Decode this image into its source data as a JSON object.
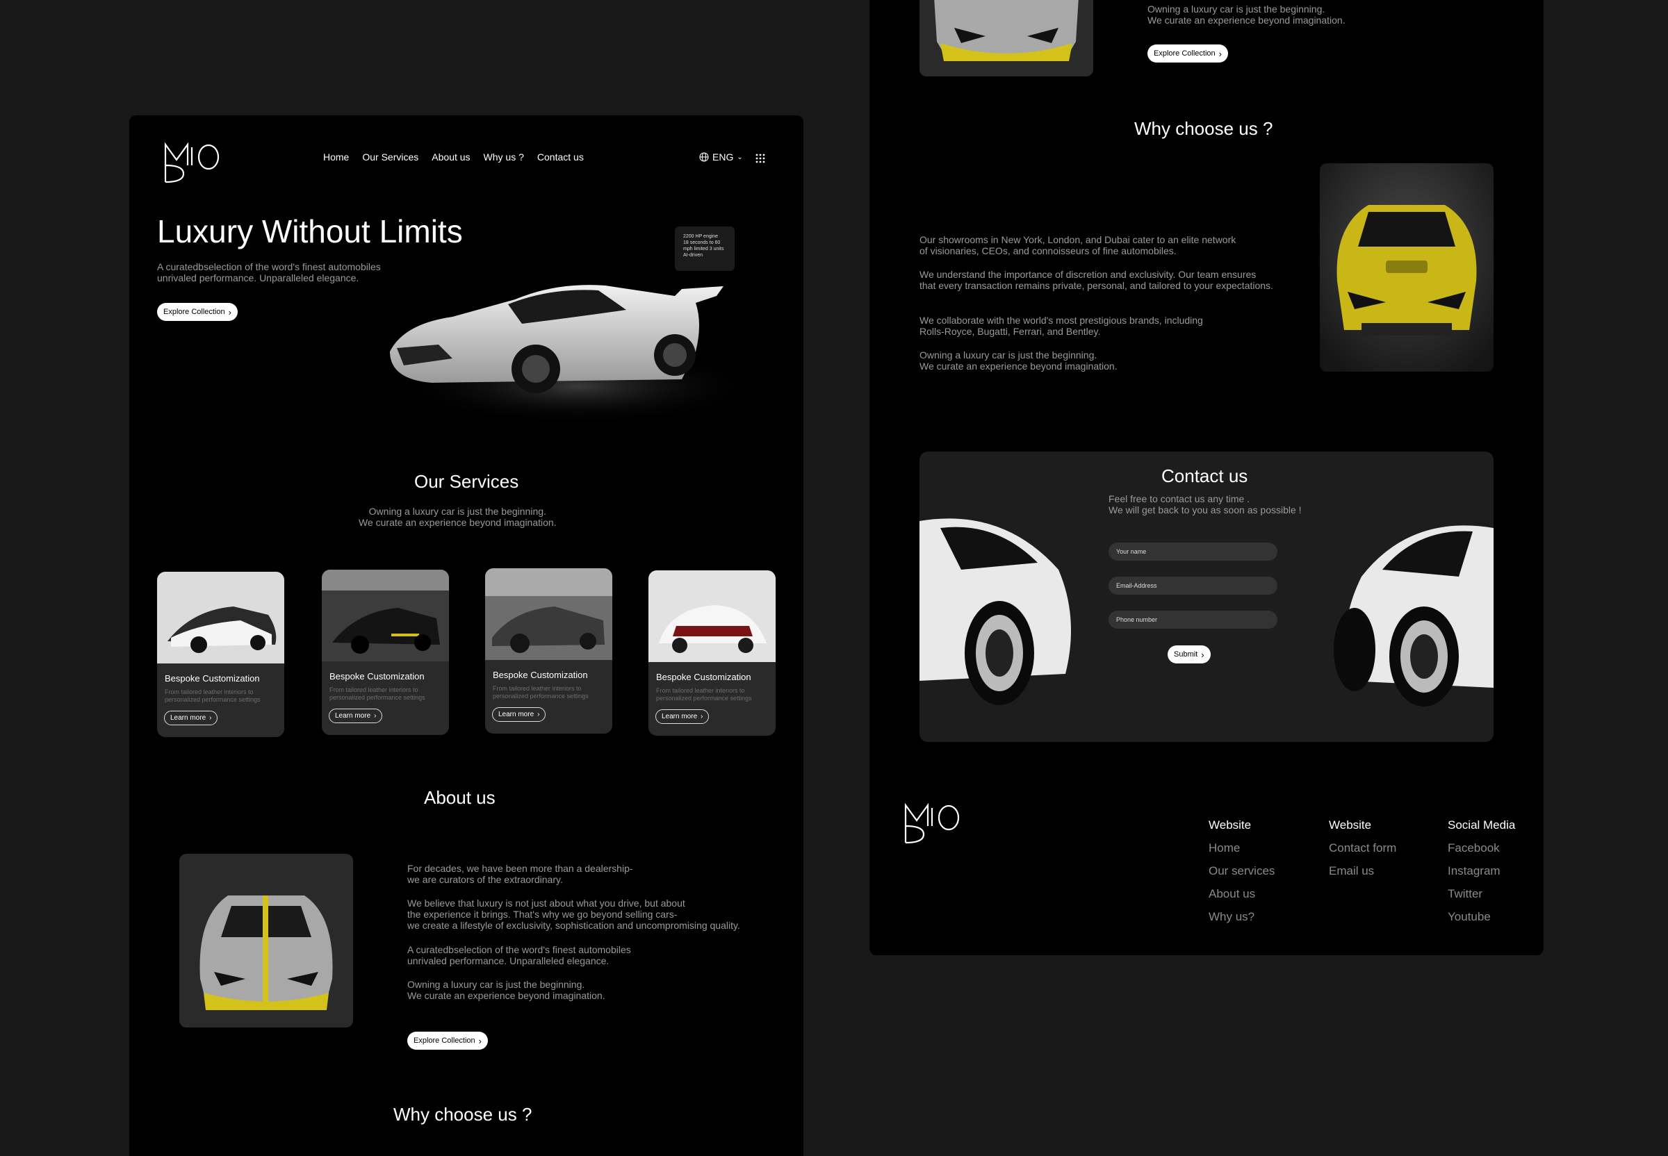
{
  "brand": {
    "logo_text": "MIOD"
  },
  "nav": {
    "items": [
      "Home",
      "Our Services",
      "About us",
      "Why us ?",
      "Contact us"
    ],
    "language": "ENG"
  },
  "hero": {
    "title": "Luxury Without Limits",
    "subtitle": "A curatedbselection of the word's finest automobiles\nunrivaled performance. Unparalleled elegance.",
    "cta": "Explore Collection",
    "spec_card": "2200 HP engine\n18 seconds to 60\nmph limited 3 units\nAI-driven"
  },
  "services": {
    "title": "Our Services",
    "subtitle": "Owning a luxury car is just the beginning.\nWe curate an experience beyond imagination.",
    "cards": [
      {
        "title": "Bespoke Customization",
        "desc": "From tailored leather interiors to\npersonalized performance settings",
        "cta": "Learn more"
      },
      {
        "title": "Bespoke Customization",
        "desc": "From tailored leather interiors to\npersonalized performance settings",
        "cta": "Learn more"
      },
      {
        "title": "Bespoke Customization",
        "desc": "From tailored leather interiors to\npersonalized performance settings",
        "cta": "Learn more"
      },
      {
        "title": "Bespoke Customization",
        "desc": "From tailored leather interiors to\npersonalized performance settings",
        "cta": "Learn more"
      }
    ]
  },
  "about": {
    "title": "About us",
    "p1": "For decades, we have been more than a dealership-\nwe are curators of the extraordinary.",
    "p2": "We believe that luxury is not just about what you drive, but about\nthe experience it brings. That's why we go beyond selling cars-\nwe create a lifestyle of exclusivity, sophistication and uncompromising quality.",
    "p3": "A curatedbselection of the word's finest automobiles\nunrivaled performance. Unparalleled elegance.",
    "p4": "Owning a luxury car is just the beginning.\nWe curate an experience beyond imagination.",
    "cta": "Explore Collection"
  },
  "why_left": {
    "title": "Why choose us ?"
  },
  "right_top": {
    "text": "Owning a luxury car is just the beginning.\nWe curate an experience beyond imagination.",
    "cta": "Explore Collection"
  },
  "why": {
    "title": "Why choose us ?",
    "p1": "Our showrooms in New York, London, and Dubai cater to an elite network\nof visionaries, CEOs, and connoisseurs of fine automobiles.",
    "p2": "We understand the importance of discretion and exclusivity. Our team ensures\nthat every transaction remains private, personal, and tailored to your expectations.",
    "p3": "We collaborate with the world's most prestigious brands, including\nRolls-Royce, Bugatti, Ferrari, and Bentley.",
    "p4": "Owning a luxury car is just the beginning.\nWe curate an experience beyond imagination."
  },
  "contact": {
    "title": "Contact us",
    "subtitle": "Feel free to contact us any time .\nWe will get back to you as soon as possible !",
    "name_placeholder": "Your name",
    "email_placeholder": "Email-Address",
    "phone_placeholder": "Phone number",
    "submit": "Submit"
  },
  "footer": {
    "columns": [
      {
        "heading": "Website",
        "items": [
          "Home",
          "Our services",
          "About us",
          "Why us?"
        ]
      },
      {
        "heading": "Website",
        "items": [
          "Contact form",
          "Email us"
        ]
      },
      {
        "heading": "Social Media",
        "items": [
          "Facebook",
          "Instagram",
          "Twitter",
          "Youtube"
        ]
      }
    ]
  },
  "colors": {
    "background": "#181818",
    "panel": "#000000",
    "card": "#2a2a2a",
    "accent_yellow": "#d4c21a"
  }
}
